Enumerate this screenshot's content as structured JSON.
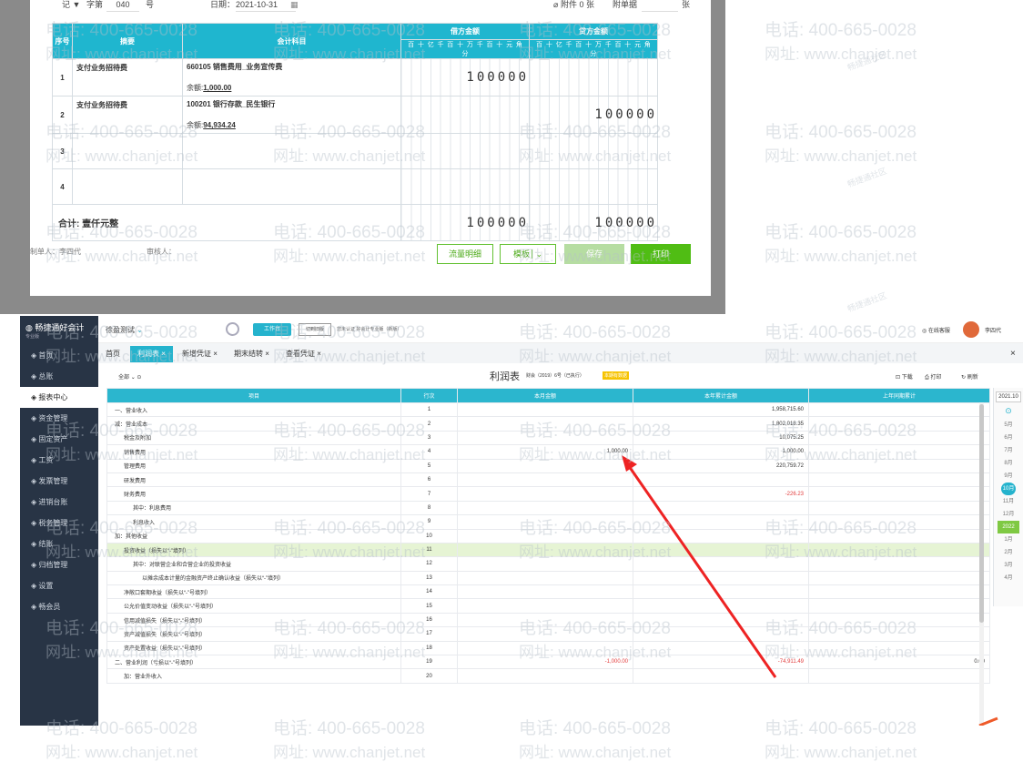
{
  "voucher": {
    "top": {
      "type": "记",
      "number_label": "字第",
      "number": "040",
      "unit": "号",
      "date_label": "日期：",
      "date": "2021-10-31",
      "attachment": "附件 0 张",
      "attach_label": "附单据",
      "attach_unit": "张"
    },
    "headers": {
      "seq": "序号",
      "summary": "摘要",
      "account": "会计科目",
      "debit": "借方金额",
      "credit": "贷方金额"
    },
    "digit_labels": [
      "百",
      "十",
      "亿",
      "千",
      "百",
      "十",
      "万",
      "千",
      "百",
      "十",
      "元",
      "角",
      "分"
    ],
    "rows": [
      {
        "seq": "1",
        "summary": "支付业务招待费",
        "account": "660105 销售费用_业务宣传费",
        "balance_label": "余额:",
        "balance": "1,000.00",
        "debit": "100000",
        "credit": ""
      },
      {
        "seq": "2",
        "summary": "支付业务招待费",
        "account": "100201 银行存款_民生银行",
        "balance_label": "余额:",
        "balance": "94,934.24",
        "debit": "",
        "credit": "100000"
      },
      {
        "seq": "3",
        "summary": "",
        "account": "",
        "balance_label": "",
        "balance": "",
        "debit": "",
        "credit": ""
      },
      {
        "seq": "4",
        "summary": "",
        "account": "",
        "balance_label": "",
        "balance": "",
        "debit": "",
        "credit": ""
      }
    ],
    "total": {
      "label": "合计:",
      "words": "壹仟元整",
      "debit": "100000",
      "credit": "100000"
    },
    "footer": {
      "maker": "制单人：李四代",
      "auditor": "审核人：",
      "flow_btn": "流量明细",
      "template_btn": "模板",
      "save_btn": "保存",
      "print_btn": "打印"
    }
  },
  "app": {
    "logo": "畅捷通好会计",
    "logo_sub": "专业版",
    "company": "徐盈测试",
    "workbench": "工作台",
    "tab_switch": "切到旧版",
    "promo": "您未认证 好会计专业版（新版）",
    "service": "在线客服",
    "user": "李四代"
  },
  "sidebar": [
    {
      "icon": "home-icon",
      "label": "首页"
    },
    {
      "icon": "ledger-icon",
      "label": "总账"
    },
    {
      "icon": "report-icon",
      "label": "报表中心"
    },
    {
      "icon": "fund-icon",
      "label": "资金管理"
    },
    {
      "icon": "asset-icon",
      "label": "固定资产"
    },
    {
      "icon": "wage-icon",
      "label": "工资"
    },
    {
      "icon": "invoice-icon",
      "label": "发票管理"
    },
    {
      "icon": "inventory-icon",
      "label": "进销台账"
    },
    {
      "icon": "tax-icon",
      "label": "税务管理"
    },
    {
      "icon": "close-icon",
      "label": "结账"
    },
    {
      "icon": "archive-icon",
      "label": "归档管理"
    },
    {
      "icon": "gear-icon",
      "label": "设置"
    },
    {
      "icon": "member-icon",
      "label": "畅会员"
    }
  ],
  "tabs": [
    "首页",
    "利润表 ×",
    "新增凭证 ×",
    "期末结转 ×",
    "查看凭证 ×"
  ],
  "report": {
    "scope": "全部",
    "title": "利润表",
    "subtitle": "财会（2019）6号（已执行）",
    "badge": "本期有数据",
    "download": "下载",
    "print": "打印",
    "refresh": "刷新",
    "headers": [
      "项目",
      "行次",
      "本月金额",
      "本年累计金额",
      "上年同期累计"
    ],
    "rows": [
      [
        "一、营业收入",
        "1",
        "",
        "1,958,715.60",
        ""
      ],
      [
        "减：营业成本",
        "2",
        "",
        "1,802,018.35",
        ""
      ],
      [
        "税金及附加",
        "3",
        "",
        "10,075.25",
        ""
      ],
      [
        "销售费用",
        "4",
        "1,000.00",
        "1,000.00",
        ""
      ],
      [
        "管理费用",
        "5",
        "",
        "220,759.72",
        ""
      ],
      [
        "研发费用",
        "6",
        "",
        "",
        ""
      ],
      [
        "财务费用",
        "7",
        "",
        "-226.23",
        ""
      ],
      [
        "其中：利息费用",
        "8",
        "",
        "",
        ""
      ],
      [
        "利息收入",
        "9",
        "",
        "",
        ""
      ],
      [
        "加：其他收益",
        "10",
        "",
        "",
        ""
      ],
      [
        "投资收益（损失以“-”填列）",
        "11",
        "",
        "",
        ""
      ],
      [
        "其中：对联营企业和合营企业的投资收益",
        "12",
        "",
        "",
        ""
      ],
      [
        "以摊余成本计量的金融资产终止确认收益（损失以“-”填列）",
        "13",
        "",
        "",
        ""
      ],
      [
        "净敞口套期收益（损失以“-”号填列）",
        "14",
        "",
        "",
        ""
      ],
      [
        "公允价值变动收益（损失以“-”号填列）",
        "15",
        "",
        "",
        ""
      ],
      [
        "信用减值损失（损失以“-”号填列）",
        "16",
        "",
        "",
        ""
      ],
      [
        "资产减值损失（损失以“-”号填列）",
        "17",
        "",
        "",
        ""
      ],
      [
        "资产处置收益（损失以“-”号填列）",
        "18",
        "",
        "",
        ""
      ],
      [
        "二、营业利润（亏损以“-”号填列）",
        "19",
        "-1,000.00",
        "-74,911.49",
        "0.00"
      ],
      [
        "加：营业外收入",
        "20",
        "",
        "",
        ""
      ]
    ]
  },
  "dates": {
    "year": "2021.10",
    "months": [
      "5月",
      "6月",
      "7月",
      "8月",
      "9月",
      "10月",
      "11月",
      "12月",
      "2022",
      "1月",
      "2月",
      "3月",
      "4月"
    ]
  },
  "watermarks": {
    "phone": "电话: 400-665-0028",
    "site": "网址: www.chanjet.net",
    "community": "畅捷通社区"
  }
}
